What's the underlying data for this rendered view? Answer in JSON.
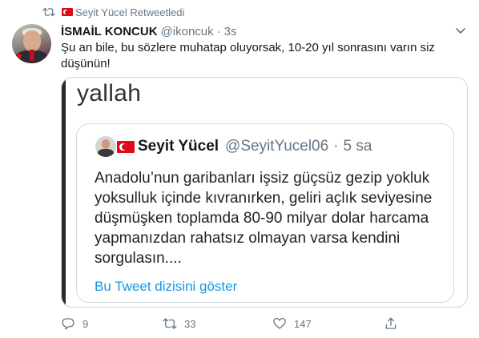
{
  "retweet_context": {
    "text": "Seyit Yücel Retweetledi"
  },
  "tweet": {
    "display_name": "İSMAİL KONCUK",
    "handle": "@ikoncuk",
    "separator": "·",
    "time": "3s",
    "text": "Şu an bile, bu sözlere muhatap oluyorsak, 10-20 yıl sonrasını varın  siz düşünün!",
    "media": {
      "caption": "yallah",
      "quoted_tweet": {
        "display_name": "Seyit Yücel",
        "handle": "@SeyitYucel06",
        "separator": "·",
        "time": "5 sa",
        "text": "Anadolu’nun garibanları işsiz güçsüz gezip yokluk yoksulluk içinde kıvranırken, geliri açlık seviyesine düşmüşken toplamda 80-90 milyar dolar harcama yapmanızdan rahatsız olmayan varsa kendini sorgulasın....",
        "thread_link": "Bu Tweet dizisini göster"
      }
    },
    "actions": {
      "reply_count": "9",
      "retweet_count": "33",
      "like_count": "147"
    }
  },
  "icons": {
    "retweet_context": "retweet-icon",
    "flag": "turkish-flag-icon",
    "more": "chevron-down-icon",
    "reply": "reply-icon",
    "retweet": "retweet-icon",
    "like": "heart-icon",
    "share": "share-icon"
  },
  "colors": {
    "secondary_text": "#657786",
    "link": "#1b95e0",
    "border": "#ccd6dd",
    "flag_red": "#e30a17"
  }
}
